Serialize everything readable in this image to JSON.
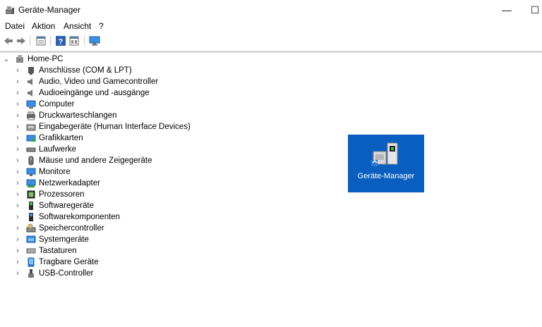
{
  "window": {
    "title": "Geräte-Manager",
    "minimize_glyph": "—",
    "maximize_glyph": "☐"
  },
  "menu": [
    "Datei",
    "Aktion",
    "Ansicht",
    "?"
  ],
  "toolbar": [
    "back-icon",
    "forward-icon",
    "properties-icon",
    "help-icon",
    "view-icon",
    "computer-monitor-icon"
  ],
  "tree": {
    "root": "Home-PC",
    "items": [
      {
        "label": "Anschlüsse (COM & LPT)",
        "icon": "port-icon"
      },
      {
        "label": "Audio, Video und Gamecontroller",
        "icon": "speaker-icon"
      },
      {
        "label": "Audioeingänge und -ausgänge",
        "icon": "speaker-icon"
      },
      {
        "label": "Computer",
        "icon": "computer-icon"
      },
      {
        "label": "Druckwarteschlangen",
        "icon": "printer-icon"
      },
      {
        "label": "Eingabegeräte (Human Interface Devices)",
        "icon": "hid-icon"
      },
      {
        "label": "Grafikkarten",
        "icon": "display-adapter-icon"
      },
      {
        "label": "Laufwerke",
        "icon": "drive-icon"
      },
      {
        "label": "Mäuse und andere Zeigegeräte",
        "icon": "mouse-icon"
      },
      {
        "label": "Monitore",
        "icon": "monitor-icon"
      },
      {
        "label": "Netzwerkadapter",
        "icon": "network-adapter-icon"
      },
      {
        "label": "Prozessoren",
        "icon": "processor-icon"
      },
      {
        "label": "Softwaregeräte",
        "icon": "software-device-icon"
      },
      {
        "label": "Softwarekomponenten",
        "icon": "software-component-icon"
      },
      {
        "label": "Speichercontroller",
        "icon": "storage-controller-icon"
      },
      {
        "label": "Systemgeräte",
        "icon": "system-device-icon"
      },
      {
        "label": "Tastaturen",
        "icon": "keyboard-icon"
      },
      {
        "label": "Tragbare Geräte",
        "icon": "portable-device-icon"
      },
      {
        "label": "USB-Controller",
        "icon": "usb-icon"
      }
    ]
  },
  "tile": {
    "label": "Geräte-Manager",
    "background": "#0a5ebf"
  }
}
